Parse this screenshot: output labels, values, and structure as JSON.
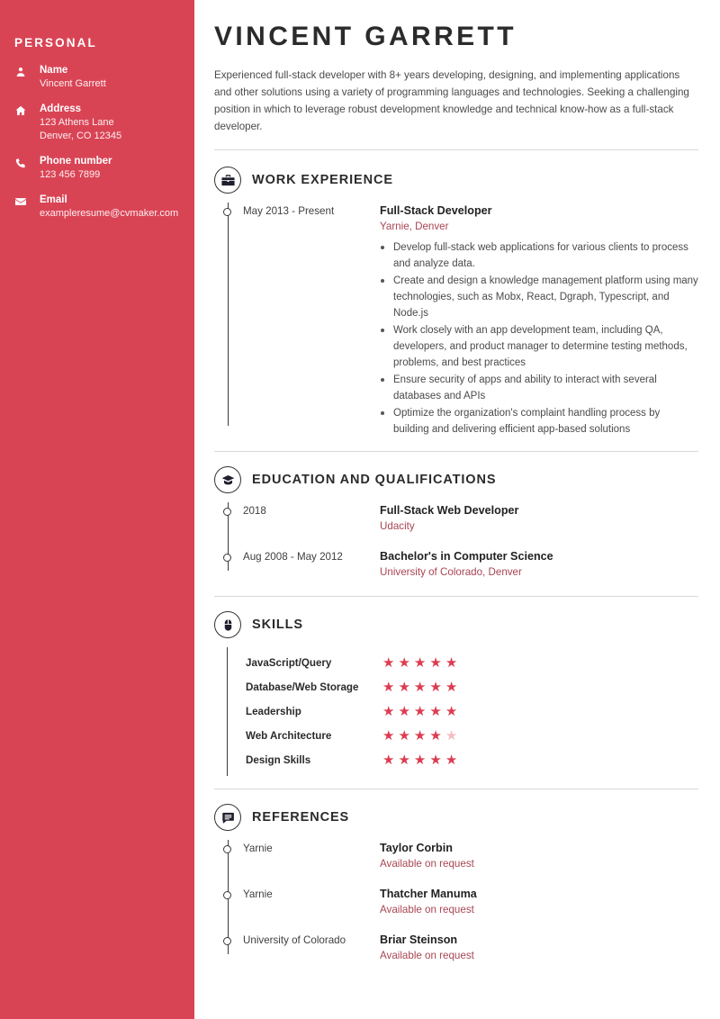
{
  "sidebar": {
    "title": "PERSONAL",
    "contacts": [
      {
        "icon": "person-icon",
        "label": "Name",
        "value": "Vincent Garrett"
      },
      {
        "icon": "home-icon",
        "label": "Address",
        "value": "123 Athens Lane\nDenver, CO 12345"
      },
      {
        "icon": "phone-icon",
        "label": "Phone number",
        "value": "123 456 7899"
      },
      {
        "icon": "envelope-icon",
        "label": "Email",
        "value": "exampleresume@cvmaker.com"
      }
    ],
    "background_color": "#D94455"
  },
  "header": {
    "name": "VINCENT GARRETT",
    "summary": "Experienced full-stack developer with 8+ years developing, designing, and implementing applications and other solutions using a variety of programming languages and technologies. Seeking a challenging position in which to leverage robust development knowledge and technical know-how as a full-stack developer."
  },
  "sections": {
    "work": {
      "icon": "briefcase-icon",
      "title": "WORK EXPERIENCE",
      "entries": [
        {
          "date": "May 2013 - Present",
          "role": "Full-Stack Developer",
          "org": "Yarnie, Denver",
          "bullets": [
            "Develop full-stack web applications for various clients to process and analyze data.",
            "Create and design a knowledge management platform using many technologies, such as Mobx, React, Dgraph, Typescript, and Node.js",
            "Work closely with an app development team, including QA, developers, and product manager to determine testing methods, problems, and best practices",
            "Ensure security of apps and ability to interact with several databases and APIs",
            "Optimize the organization's complaint handling process by building and delivering efficient app-based solutions"
          ]
        }
      ]
    },
    "education": {
      "icon": "graduation-cap-icon",
      "title": "EDUCATION AND QUALIFICATIONS",
      "entries": [
        {
          "date": "2018",
          "role": "Full-Stack Web Developer",
          "org": "Udacity"
        },
        {
          "date": "Aug 2008 - May 2012",
          "role": "Bachelor's in Computer Science",
          "org": "University of Colorado, Denver"
        }
      ]
    },
    "skills": {
      "icon": "mouse-icon",
      "title": "SKILLS",
      "max_rating": 5,
      "items": [
        {
          "name": "JavaScript/Query",
          "rating": 5
        },
        {
          "name": "Database/Web Storage",
          "rating": 5
        },
        {
          "name": "Leadership",
          "rating": 5
        },
        {
          "name": "Web Architecture",
          "rating": 4
        },
        {
          "name": "Design Skills",
          "rating": 5
        }
      ],
      "star_color": "#DC3C51",
      "star_empty_color": "#F5BDC4"
    },
    "references": {
      "icon": "speech-bubble-icon",
      "title": "REFERENCES",
      "entries": [
        {
          "date": "Yarnie",
          "role": "Taylor Corbin",
          "org": "Available on request"
        },
        {
          "date": "Yarnie",
          "role": "Thatcher Manuma",
          "org": "Available on request"
        },
        {
          "date": "University of Colorado",
          "role": "Briar Steinson",
          "org": "Available on request"
        }
      ]
    }
  }
}
